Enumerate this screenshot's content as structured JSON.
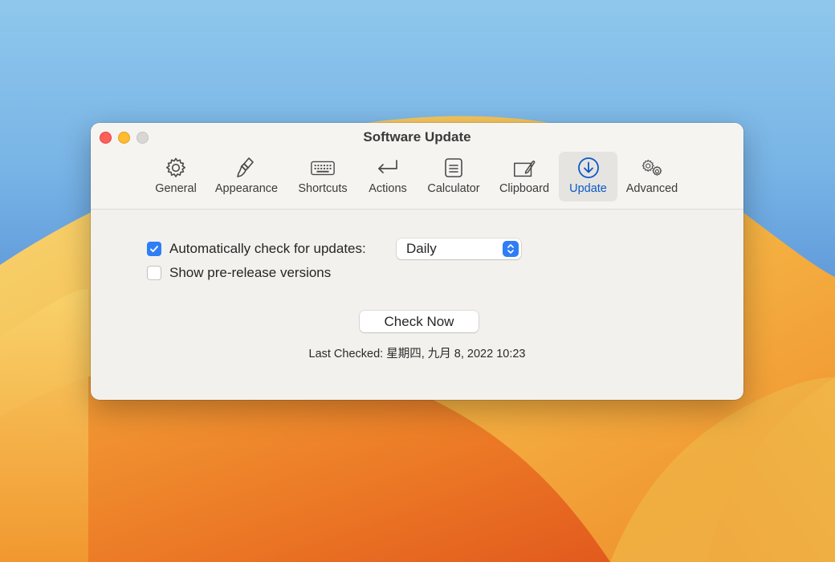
{
  "window": {
    "title": "Software Update"
  },
  "toolbar": {
    "tabs": [
      {
        "label": "General",
        "icon": "gear-icon"
      },
      {
        "label": "Appearance",
        "icon": "brush-icon"
      },
      {
        "label": "Shortcuts",
        "icon": "keyboard-icon"
      },
      {
        "label": "Actions",
        "icon": "return-arrow-icon"
      },
      {
        "label": "Calculator",
        "icon": "calculator-icon"
      },
      {
        "label": "Clipboard",
        "icon": "clipboard-icon"
      },
      {
        "label": "Update",
        "icon": "download-circle-icon",
        "active": true
      },
      {
        "label": "Advanced",
        "icon": "gears-icon"
      }
    ]
  },
  "settings": {
    "auto_check": {
      "label": "Automatically check for updates:",
      "checked": true
    },
    "frequency": {
      "selected": "Daily"
    },
    "prerelease": {
      "label": "Show pre-release versions",
      "checked": false
    }
  },
  "actions": {
    "check_now_label": "Check Now"
  },
  "status": {
    "last_checked": "Last Checked: 星期四, 九月 8, 2022 10:23"
  },
  "colors": {
    "accent": "#2f7ef5",
    "active_tab_text": "#0a59c7",
    "close": "#fe5f57",
    "minimize": "#febc2e",
    "zoom_disabled": "#d9d7d4"
  }
}
